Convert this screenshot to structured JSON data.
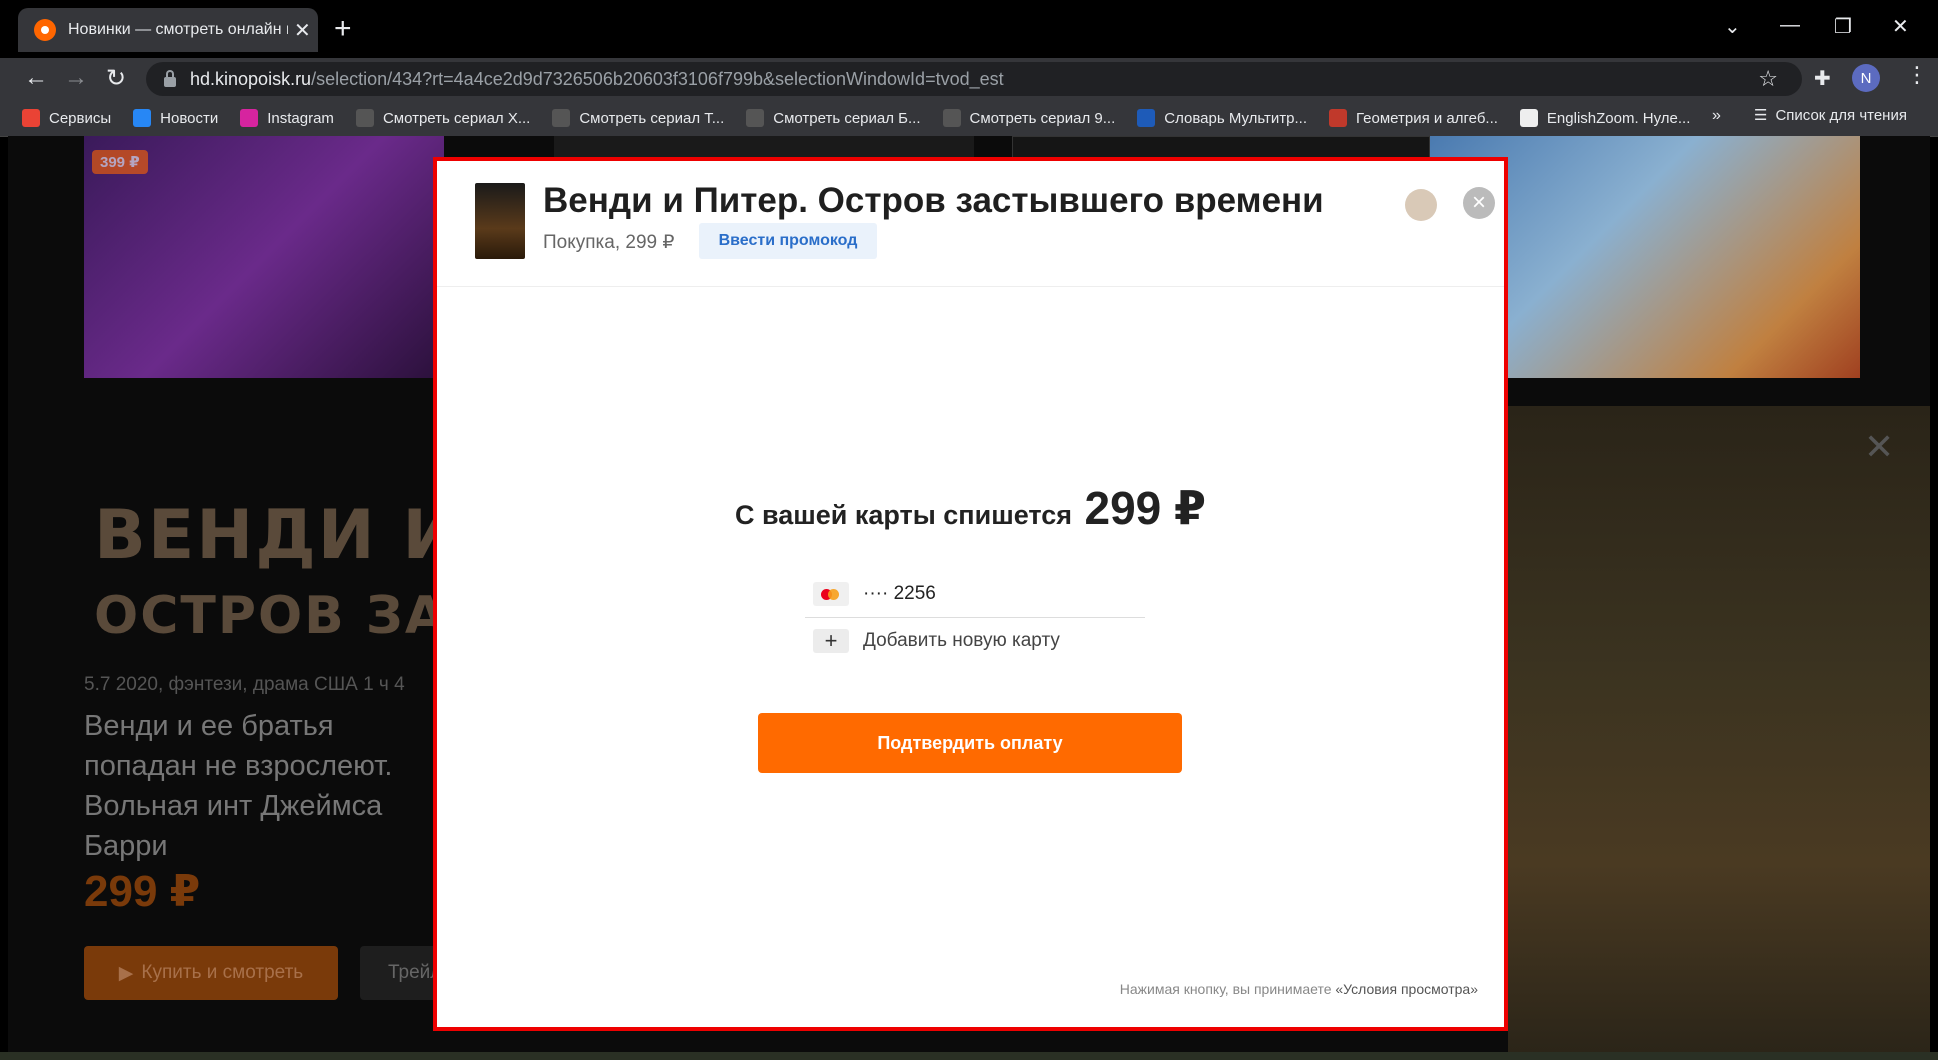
{
  "browser": {
    "tab_title": "Новинки — смотреть онлайн в",
    "url_host": "hd.kinopoisk.ru",
    "url_path": "/selection/434?rt=4a4ce2d9d7326506b20603f3106f799b&selectionWindowId=tvod_est",
    "profile_initial": "N",
    "bookmarks": [
      {
        "label": "Сервисы",
        "icon": "apps-grid-icon",
        "color": "#ea4335"
      },
      {
        "label": "Новости",
        "icon": "vk-icon",
        "color": "#2787f5"
      },
      {
        "label": "Instagram",
        "icon": "instagram-icon",
        "color": "#d6249f"
      },
      {
        "label": "Смотреть сериал Х...",
        "icon": "hd-icon",
        "color": "#555555"
      },
      {
        "label": "Смотреть сериал Т...",
        "icon": "hd-icon",
        "color": "#555555"
      },
      {
        "label": "Смотреть сериал Б...",
        "icon": "hd-icon",
        "color": "#555555"
      },
      {
        "label": "Смотреть сериал 9...",
        "icon": "hd-icon",
        "color": "#555555"
      },
      {
        "label": "Словарь Мультитр...",
        "icon": "multitran-icon",
        "color": "#1e5bb8"
      },
      {
        "label": "Геометрия и алгеб...",
        "icon": "bookmark-icon",
        "color": "#c0392b"
      },
      {
        "label": "EnglishZoom. Нуле...",
        "icon": "ez-icon",
        "color": "#eeeeee"
      }
    ],
    "bookmarks_more": "»",
    "reading_list": "Список для чтения"
  },
  "background": {
    "top_price": "399 ₽",
    "title_line1": "ВЕНДИ И П",
    "title_line2": "ОСТРОВ ЗАСТЫВШЕ",
    "meta": "5.7   2020, фэнтези, драма   США   1 ч 4",
    "description": "Венди и ее братья попадан не взрослеют. Вольная инт Джеймса Барри",
    "price": "299 ₽",
    "buy_button": "Купить и смотреть",
    "trailer_button": "Трейл"
  },
  "modal": {
    "title": "Венди и Питер. Остров застывшего времени",
    "subtitle": "Покупка, 299 ₽",
    "promo_button": "Ввести промокод",
    "charge_label": "С вашей карты спишется",
    "charge_amount": "299 ₽",
    "card_number": "···· 2256",
    "add_card": "Добавить новую карту",
    "confirm_button": "Подтвердить оплату",
    "terms_text": "Нажимая кнопку, вы принимаете ",
    "terms_link": "«Условия просмотра»"
  }
}
